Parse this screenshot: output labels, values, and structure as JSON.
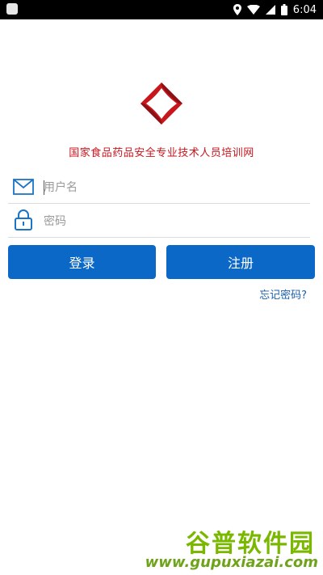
{
  "status_bar": {
    "time": "6:04",
    "icons": [
      "notification-icon",
      "location-icon",
      "wifi-icon",
      "signal-icon",
      "battery-icon"
    ]
  },
  "app": {
    "title": "国家食品药品安全专业技术人员培训网",
    "logo": "red-diamond-logo"
  },
  "login_form": {
    "username_placeholder": "用户名",
    "password_placeholder": "密码",
    "login_label": "登录",
    "register_label": "注册",
    "forgot_label": "忘记密码?"
  },
  "watermark": {
    "brand": "谷普软件园",
    "url": "www.gupuxiazai.com"
  },
  "colors": {
    "accent": "#0b68c6",
    "title_red": "#c8161d",
    "link": "#1a5fae"
  }
}
